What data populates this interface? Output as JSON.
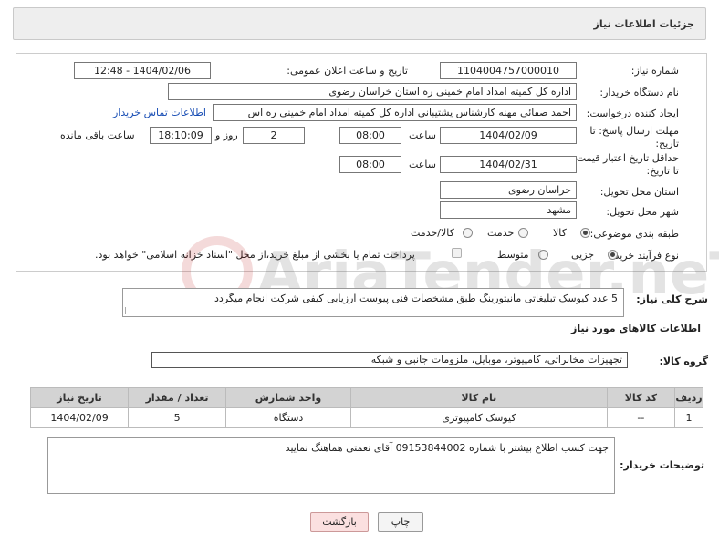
{
  "page_title": "جزئیات اطلاعات نیاز",
  "fields": {
    "need_number_label": "شماره نیاز:",
    "need_number": "1104004757000010",
    "announce_label": "تاریخ و ساعت اعلان عمومی:",
    "announce_value": "1404/02/06 - 12:48",
    "buyer_org_label": "نام دستگاه خریدار:",
    "buyer_org": "اداره کل کمیته امداد امام خمینی  ره  استان خراسان رضوی",
    "requester_label": "ایجاد کننده درخواست:",
    "requester": "احمد صفائی مهنه کارشناس پشتیبانی اداره کل کمیته امداد امام خمینی  ره  اس",
    "contact_link": "اطلاعات تماس خریدار",
    "deadline_label_1": "مهلت ارسال پاسخ: تا",
    "deadline_label_2": "تاریخ:",
    "deadline_date": "1404/02/09",
    "time_label": "ساعت",
    "deadline_time": "08:00",
    "days_value": "2",
    "days_label": "روز و",
    "remaining_time": "18:10:09",
    "remaining_label": "ساعت باقی مانده",
    "validity_label_1": "حداقل تاریخ اعتبار قیمت:",
    "validity_label_2": "تا تاریخ:",
    "validity_date": "1404/02/31",
    "validity_time": "08:00",
    "province_label": "استان محل تحویل:",
    "province": "خراسان رضوی",
    "city_label": "شهر محل تحویل:",
    "city": "مشهد",
    "category_label": "طبقه بندی موضوعی:",
    "category_options": [
      "کالا",
      "خدمت",
      "کالا/خدمت"
    ],
    "process_label": "نوع فرآیند خرید :",
    "process_options": [
      "جزیی",
      "متوسط"
    ],
    "payment_note": "پرداخت تمام یا بخشی از مبلغ خرید،از محل \"اسناد خزانه اسلامی\" خواهد بود."
  },
  "description": {
    "label": "شرح کلی نیاز:",
    "text": "5 عدد کیوسک تبلیغاتی مانیتورینگ طبق مشخصات فنی  پیوست ارزیابی کیفی شرکت انجام میگردد"
  },
  "goods_section": {
    "title": "اطلاعات کالاهای مورد نیاز",
    "group_label": "گروه کالا:",
    "group_value": "تجهیزات مخابراتی، کامپیوتر، موبایل، ملزومات جانبی و شبکه"
  },
  "table": {
    "headers": [
      "ردیف",
      "کد کالا",
      "نام کالا",
      "واحد شمارش",
      "تعداد / مقدار",
      "تاریخ نیاز"
    ],
    "rows": [
      [
        "1",
        "--",
        "کیوسک کامپیوتری",
        "دستگاه",
        "5",
        "1404/02/09"
      ]
    ]
  },
  "buyer_notes": {
    "label": "توضیحات خریدار:",
    "text": "جهت کسب اطلاع بیشتر با شماره 09153844002 آقای نعمتی هماهنگ نمایید"
  },
  "buttons": {
    "print": "چاپ",
    "back": "بازگشت"
  },
  "watermark": {
    "text": "AriaTender.neT"
  }
}
